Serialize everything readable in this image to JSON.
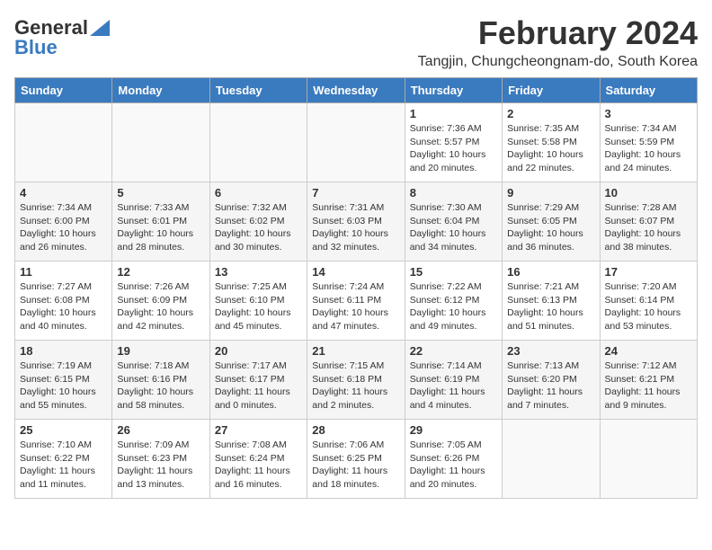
{
  "logo": {
    "line1": "General",
    "line2": "Blue"
  },
  "title": {
    "month": "February 2024",
    "location": "Tangjin, Chungcheongnam-do, South Korea"
  },
  "headers": [
    "Sunday",
    "Monday",
    "Tuesday",
    "Wednesday",
    "Thursday",
    "Friday",
    "Saturday"
  ],
  "weeks": [
    [
      {
        "day": "",
        "info": ""
      },
      {
        "day": "",
        "info": ""
      },
      {
        "day": "",
        "info": ""
      },
      {
        "day": "",
        "info": ""
      },
      {
        "day": "1",
        "info": "Sunrise: 7:36 AM\nSunset: 5:57 PM\nDaylight: 10 hours and 20 minutes."
      },
      {
        "day": "2",
        "info": "Sunrise: 7:35 AM\nSunset: 5:58 PM\nDaylight: 10 hours and 22 minutes."
      },
      {
        "day": "3",
        "info": "Sunrise: 7:34 AM\nSunset: 5:59 PM\nDaylight: 10 hours and 24 minutes."
      }
    ],
    [
      {
        "day": "4",
        "info": "Sunrise: 7:34 AM\nSunset: 6:00 PM\nDaylight: 10 hours and 26 minutes."
      },
      {
        "day": "5",
        "info": "Sunrise: 7:33 AM\nSunset: 6:01 PM\nDaylight: 10 hours and 28 minutes."
      },
      {
        "day": "6",
        "info": "Sunrise: 7:32 AM\nSunset: 6:02 PM\nDaylight: 10 hours and 30 minutes."
      },
      {
        "day": "7",
        "info": "Sunrise: 7:31 AM\nSunset: 6:03 PM\nDaylight: 10 hours and 32 minutes."
      },
      {
        "day": "8",
        "info": "Sunrise: 7:30 AM\nSunset: 6:04 PM\nDaylight: 10 hours and 34 minutes."
      },
      {
        "day": "9",
        "info": "Sunrise: 7:29 AM\nSunset: 6:05 PM\nDaylight: 10 hours and 36 minutes."
      },
      {
        "day": "10",
        "info": "Sunrise: 7:28 AM\nSunset: 6:07 PM\nDaylight: 10 hours and 38 minutes."
      }
    ],
    [
      {
        "day": "11",
        "info": "Sunrise: 7:27 AM\nSunset: 6:08 PM\nDaylight: 10 hours and 40 minutes."
      },
      {
        "day": "12",
        "info": "Sunrise: 7:26 AM\nSunset: 6:09 PM\nDaylight: 10 hours and 42 minutes."
      },
      {
        "day": "13",
        "info": "Sunrise: 7:25 AM\nSunset: 6:10 PM\nDaylight: 10 hours and 45 minutes."
      },
      {
        "day": "14",
        "info": "Sunrise: 7:24 AM\nSunset: 6:11 PM\nDaylight: 10 hours and 47 minutes."
      },
      {
        "day": "15",
        "info": "Sunrise: 7:22 AM\nSunset: 6:12 PM\nDaylight: 10 hours and 49 minutes."
      },
      {
        "day": "16",
        "info": "Sunrise: 7:21 AM\nSunset: 6:13 PM\nDaylight: 10 hours and 51 minutes."
      },
      {
        "day": "17",
        "info": "Sunrise: 7:20 AM\nSunset: 6:14 PM\nDaylight: 10 hours and 53 minutes."
      }
    ],
    [
      {
        "day": "18",
        "info": "Sunrise: 7:19 AM\nSunset: 6:15 PM\nDaylight: 10 hours and 55 minutes."
      },
      {
        "day": "19",
        "info": "Sunrise: 7:18 AM\nSunset: 6:16 PM\nDaylight: 10 hours and 58 minutes."
      },
      {
        "day": "20",
        "info": "Sunrise: 7:17 AM\nSunset: 6:17 PM\nDaylight: 11 hours and 0 minutes."
      },
      {
        "day": "21",
        "info": "Sunrise: 7:15 AM\nSunset: 6:18 PM\nDaylight: 11 hours and 2 minutes."
      },
      {
        "day": "22",
        "info": "Sunrise: 7:14 AM\nSunset: 6:19 PM\nDaylight: 11 hours and 4 minutes."
      },
      {
        "day": "23",
        "info": "Sunrise: 7:13 AM\nSunset: 6:20 PM\nDaylight: 11 hours and 7 minutes."
      },
      {
        "day": "24",
        "info": "Sunrise: 7:12 AM\nSunset: 6:21 PM\nDaylight: 11 hours and 9 minutes."
      }
    ],
    [
      {
        "day": "25",
        "info": "Sunrise: 7:10 AM\nSunset: 6:22 PM\nDaylight: 11 hours and 11 minutes."
      },
      {
        "day": "26",
        "info": "Sunrise: 7:09 AM\nSunset: 6:23 PM\nDaylight: 11 hours and 13 minutes."
      },
      {
        "day": "27",
        "info": "Sunrise: 7:08 AM\nSunset: 6:24 PM\nDaylight: 11 hours and 16 minutes."
      },
      {
        "day": "28",
        "info": "Sunrise: 7:06 AM\nSunset: 6:25 PM\nDaylight: 11 hours and 18 minutes."
      },
      {
        "day": "29",
        "info": "Sunrise: 7:05 AM\nSunset: 6:26 PM\nDaylight: 11 hours and 20 minutes."
      },
      {
        "day": "",
        "info": ""
      },
      {
        "day": "",
        "info": ""
      }
    ]
  ]
}
